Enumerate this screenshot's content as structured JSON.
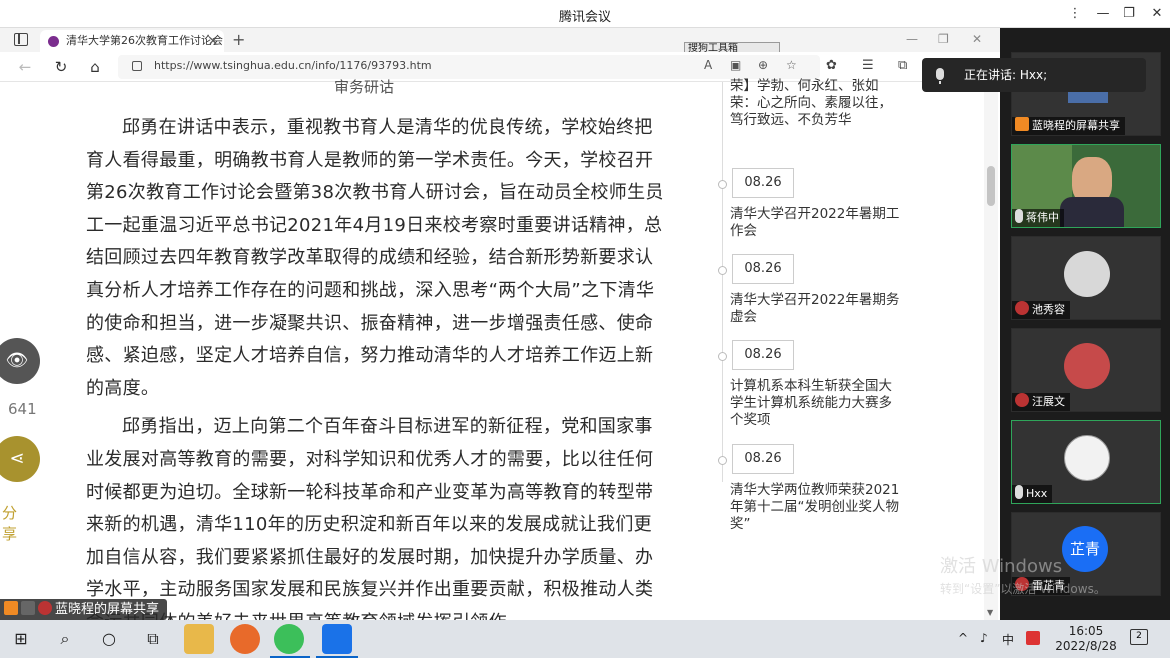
{
  "meeting": {
    "title": "腾讯会议"
  },
  "browser": {
    "tab_title": "清华大学第26次教育工作讨论会",
    "url": "https://www.tsinghua.edu.cn/info/1176/93793.htm",
    "ime_label": "搜狗工具箱"
  },
  "article": {
    "partial_heading": "审务研诂",
    "paragraphs": [
      "邱勇在讲话中表示，重视教书育人是清华的优良传统，学校始终把育人看得最重，明确教书育人是教师的第一学术责任。今天，学校召开第26次教育工作讨论会暨第38次教书育人研讨会，旨在动员全校师生员工一起重温习近平总书记2021年4月19日来校考察时重要讲话精神，总结回顾过去四年教育教学改革取得的成绩和经验，结合新形势新要求认真分析人才培养工作存在的问题和挑战，深入思考“两个大局”之下清华的使命和担当，进一步凝聚共识、振奋精神，进一步增强责任感、使命感、紧迫感，坚定人才培养自信，努力推动清华的人才培养工作迈上新的高度。",
      "邱勇指出，迈上向第二个百年奋斗目标进军的新征程，党和国家事业发展对高等教育的需要，对科学知识和优秀人才的需要，比以往任何时候都更为迫切。全球新一轮科技革命和产业变革为高等教育的转型带来新的机遇，清华110年的历史积淀和新百年以来的发展成就让我们更加自信从容，我们要紧紧抓住最好的发展时期，加快提升办学质量、办学水平，主动服务国家发展和民族复兴并作出重要贡献，积极推动人类命运共同体的美好未来世界高等教育领域发挥引领作"
    ]
  },
  "float_actions": {
    "view_count": "641",
    "share_label": "分享"
  },
  "timeline": {
    "top_text": "荣】学勃、何永红、张如荣：心之所向、素履以往，笃行致远、不负芳华",
    "items": [
      {
        "date": "08.26",
        "text": "清华大学召开2022年暑期工作会"
      },
      {
        "date": "08.26",
        "text": "清华大学召开2022年暑期务虚会"
      },
      {
        "date": "08.26",
        "text": "计算机系本科生斩获全国大学生计算机系统能力大赛多个奖项"
      },
      {
        "date": "08.26",
        "text": "清华大学两位教师荣获2021年第十二届“发明创业奖人物奖”"
      }
    ]
  },
  "presenter_tag": "蓝晓程的屏幕共享",
  "speaking": {
    "label": "正在讲话: Hxx;"
  },
  "participants": [
    {
      "name": "蓝晓程的屏幕共享"
    },
    {
      "name": "蒋伟中"
    },
    {
      "name": "池秀容"
    },
    {
      "name": "汪展文"
    },
    {
      "name": "Hxx"
    },
    {
      "name": "雷芷青",
      "avatar_text": "芷青"
    }
  ],
  "watermark": {
    "line1": "激活 Windows",
    "line2": "转到“设置”以激活 Windows。"
  },
  "taskbar": {
    "time": "16:05",
    "date": "2022/8/28",
    "ime": "中"
  },
  "colors": {
    "accent_green": "#2fa55a",
    "avatar_blue": "#1a6ef5",
    "share_gold": "#a8922e"
  }
}
